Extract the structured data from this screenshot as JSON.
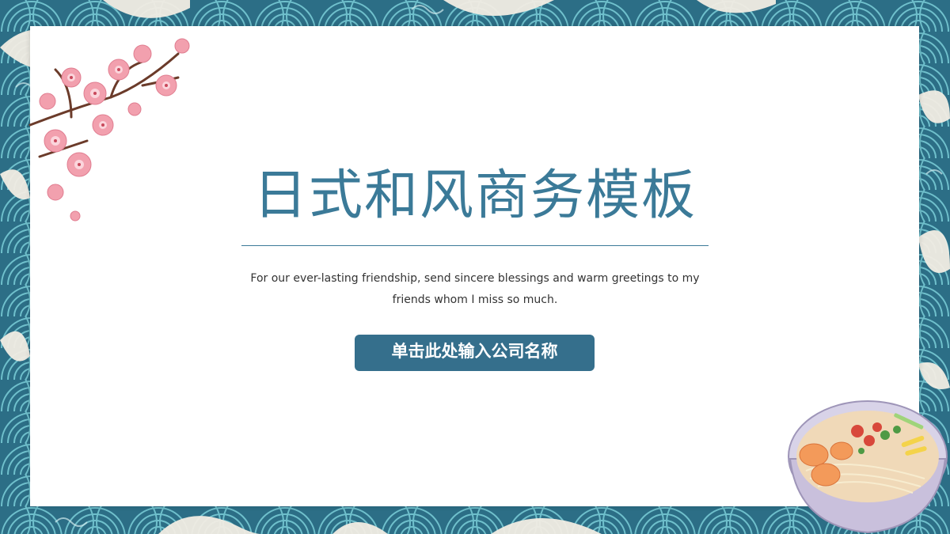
{
  "slide": {
    "title": "日式和风商务模板",
    "subtitle": "For our ever-lasting friendship, send sincere blessings and warm greetings to my friends whom I miss so much.",
    "company_placeholder": "单击此处输入公司名称"
  },
  "colors": {
    "accent": "#3b7a98",
    "button": "#356f8c",
    "wave_dark": "#2c6e86",
    "wave_mid": "#3f97aa",
    "wave_light": "#f1ece3",
    "blossom": "#f2a0ae"
  },
  "icons": {
    "corner_top_left": "cherry-blossom-icon",
    "corner_bottom_right": "ramen-bowl-icon"
  }
}
